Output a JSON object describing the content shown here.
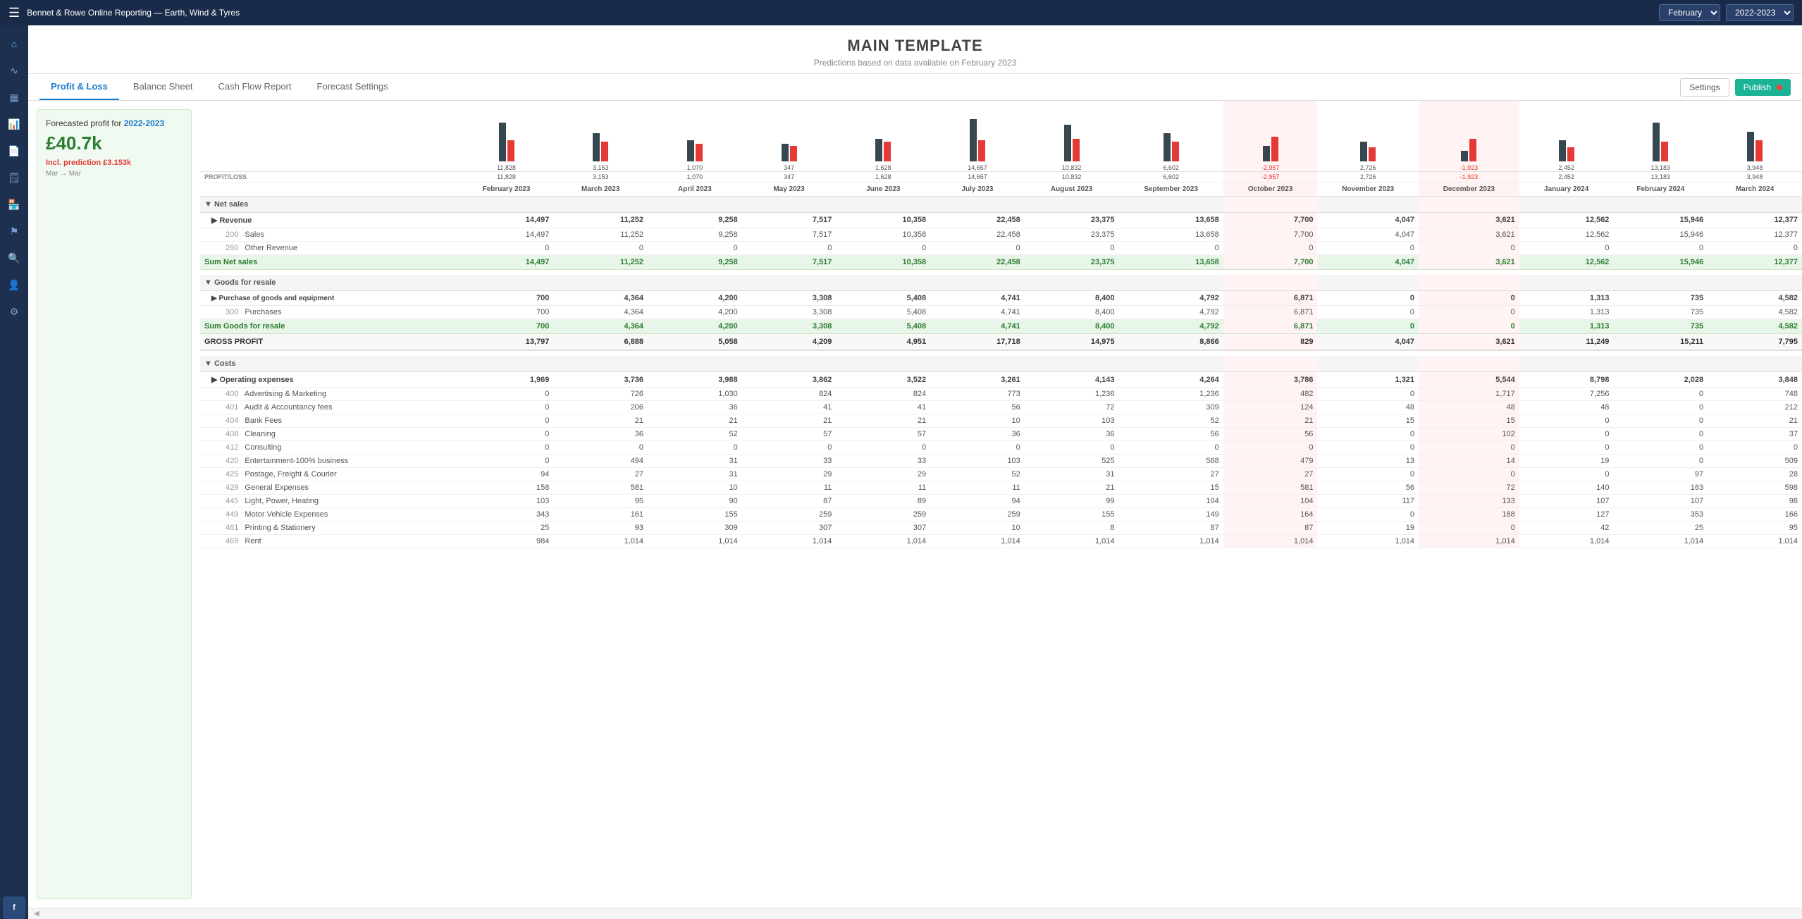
{
  "topBar": {
    "hamburger": "☰",
    "title": "Bennet & Rowe Online Reporting — Earth, Wind & Tyres",
    "monthSelector": "February",
    "yearSelector": "2022-2023"
  },
  "pageHeader": {
    "title": "MAIN TEMPLATE",
    "subtitle": "Predictions based on data available on February 2023"
  },
  "tabs": [
    {
      "id": "pl",
      "label": "Profit & Loss",
      "active": true
    },
    {
      "id": "bs",
      "label": "Balance Sheet",
      "active": false
    },
    {
      "id": "cfr",
      "label": "Cash Flow Report",
      "active": false
    },
    {
      "id": "fs",
      "label": "Forecast Settings",
      "active": false
    }
  ],
  "tabActions": {
    "settingsLabel": "Settings",
    "publishLabel": "Publish"
  },
  "forecastCard": {
    "forecastLabel": "Forecasted profit for",
    "forecastYear": "2022-2023",
    "amount": "£40.7k",
    "inclLabel": "Incl. prediction",
    "inclAmount": "£3.153k",
    "periodFrom": "Mar",
    "periodTo": "Mar"
  },
  "columns": [
    {
      "id": "feb23",
      "period": "February 2023",
      "profit": "11,828",
      "barDark": 55,
      "barRed": 30,
      "positive": true
    },
    {
      "id": "mar23",
      "period": "March 2023",
      "profit": "3,153",
      "barDark": 40,
      "barRed": 28,
      "positive": true
    },
    {
      "id": "apr23",
      "period": "April 2023",
      "profit": "1,070",
      "barDark": 30,
      "barRed": 25,
      "positive": true
    },
    {
      "id": "may23",
      "period": "May 2023",
      "profit": "347",
      "barDark": 25,
      "barRed": 22,
      "positive": true
    },
    {
      "id": "jun23",
      "period": "June 2023",
      "profit": "1,628",
      "barDark": 32,
      "barRed": 28,
      "positive": true
    },
    {
      "id": "jul23",
      "period": "July 2023",
      "profit": "14,657",
      "barDark": 60,
      "barRed": 30,
      "positive": true
    },
    {
      "id": "aug23",
      "period": "August 2023",
      "profit": "10,832",
      "barDark": 52,
      "barRed": 32,
      "positive": true
    },
    {
      "id": "sep23",
      "period": "September 2023",
      "profit": "6,602",
      "barDark": 40,
      "barRed": 28,
      "positive": true
    },
    {
      "id": "oct23",
      "period": "October 2023",
      "profit": "-2,957",
      "barDark": 22,
      "barRed": 35,
      "positive": false
    },
    {
      "id": "nov23",
      "period": "November 2023",
      "profit": "2,726",
      "barDark": 28,
      "barRed": 20,
      "positive": true
    },
    {
      "id": "dec23",
      "period": "December 2023",
      "profit": "-1,923",
      "barDark": 15,
      "barRed": 32,
      "positive": false
    },
    {
      "id": "jan24",
      "period": "January 2024",
      "profit": "2,452",
      "barDark": 30,
      "barRed": 20,
      "positive": true
    },
    {
      "id": "feb24",
      "period": "February 2024",
      "profit": "13,183",
      "barDark": 55,
      "barRed": 28,
      "positive": true
    },
    {
      "id": "mar24",
      "period": "March 2024",
      "profit": "3,948",
      "barDark": 42,
      "barRed": 30,
      "positive": true
    }
  ],
  "rows": {
    "netSalesLabel": "Net sales",
    "revenueLabel": "▶ Revenue",
    "salesCode": "200",
    "salesLabel": "Sales",
    "otherRevenueCode": "260",
    "otherRevenueLabel": "Other Revenue",
    "sumNetSalesLabel": "Sum Net sales",
    "goodsForResaleLabel": "Goods for resale",
    "purchaseLabel": "▶ Purchase of goods and equipment",
    "purchasesCode": "300",
    "purchasesLabel": "Purchases",
    "sumGoodsLabel": "Sum Goods for resale",
    "grossProfitLabel": "GROSS PROFIT",
    "costsLabel": "Costs",
    "operatingExpensesLabel": "▶ Operating expenses",
    "advertisingCode": "400",
    "advertisingLabel": "Advertising & Marketing",
    "auditCode": "401",
    "auditLabel": "Audit & Accountancy fees",
    "bankCode": "404",
    "bankLabel": "Bank Fees",
    "cleaningCode": "408",
    "cleaningLabel": "Cleaning",
    "consultingCode": "412",
    "consultingLabel": "Consulting",
    "entertainmentCode": "420",
    "entertainmentLabel": "Entertainment-100% business",
    "postageCode": "425",
    "postageLabel": "Postage, Freight & Courier",
    "generalCode": "429",
    "generalLabel": "General Expenses",
    "lightCode": "445",
    "lightLabel": "Light, Power, Heating",
    "motorCode": "449",
    "motorLabel": "Motor Vehicle Expenses",
    "printingCode": "461",
    "printingLabel": "Printing & Stationery",
    "rentCode": "469",
    "rentLabel": "Rent"
  },
  "data": {
    "netSales": {
      "revenue": [
        14497,
        11252,
        9258,
        7517,
        10358,
        22458,
        23375,
        13658,
        7700,
        4047,
        3621,
        12562,
        15946,
        12377
      ],
      "sales": [
        14497,
        11252,
        9258,
        7517,
        10358,
        22458,
        23375,
        13658,
        7700,
        4047,
        3621,
        12562,
        15946,
        12377
      ],
      "otherRevenue": [
        0,
        0,
        0,
        0,
        0,
        0,
        0,
        0,
        0,
        0,
        0,
        0,
        0,
        0
      ],
      "sumNetSales": [
        14497,
        11252,
        9258,
        7517,
        10358,
        22458,
        23375,
        13658,
        7700,
        4047,
        3621,
        12562,
        15946,
        12377
      ]
    },
    "goodsForResale": {
      "purchase": [
        700,
        4364,
        4200,
        3308,
        5408,
        4741,
        8400,
        4792,
        6871,
        0,
        0,
        1313,
        735,
        4582
      ],
      "purchases": [
        700,
        4364,
        4200,
        3308,
        5408,
        4741,
        8400,
        4792,
        6871,
        0,
        0,
        1313,
        735,
        4582
      ],
      "sumGoods": [
        700,
        4364,
        4200,
        3308,
        5408,
        4741,
        8400,
        4792,
        6871,
        0,
        0,
        1313,
        735,
        4582
      ]
    },
    "grossProfit": [
      13797,
      6888,
      5058,
      4209,
      4951,
      17718,
      14975,
      8866,
      829,
      4047,
      3621,
      11249,
      15211,
      7795
    ],
    "costs": {
      "operatingExpenses": [
        1969,
        3736,
        3988,
        3862,
        3522,
        3261,
        4143,
        4264,
        3786,
        1321,
        5544,
        8798,
        2028,
        3848
      ],
      "advertising": [
        0,
        726,
        1030,
        824,
        824,
        773,
        1236,
        1236,
        482,
        0,
        1717,
        7256,
        0,
        748
      ],
      "audit": [
        0,
        206,
        36,
        41,
        41,
        56,
        72,
        309,
        124,
        48,
        48,
        48,
        0,
        212
      ],
      "bank": [
        0,
        21,
        21,
        21,
        21,
        10,
        103,
        52,
        21,
        15,
        15,
        0,
        0,
        21
      ],
      "cleaning": [
        0,
        36,
        52,
        57,
        57,
        36,
        36,
        56,
        56,
        0,
        102,
        0,
        0,
        37
      ],
      "consulting": [
        0,
        0,
        0,
        0,
        0,
        0,
        0,
        0,
        0,
        0,
        0,
        0,
        0,
        0
      ],
      "entertainment": [
        0,
        494,
        31,
        33,
        33,
        103,
        525,
        568,
        479,
        13,
        14,
        19,
        0,
        509
      ],
      "postage": [
        94,
        27,
        31,
        29,
        29,
        52,
        31,
        27,
        27,
        0,
        0,
        0,
        97,
        28
      ],
      "general": [
        158,
        581,
        10,
        11,
        11,
        11,
        21,
        15,
        581,
        56,
        72,
        140,
        163,
        598
      ],
      "light": [
        103,
        95,
        90,
        87,
        89,
        94,
        99,
        104,
        104,
        117,
        133,
        107,
        107,
        98
      ],
      "motor": [
        343,
        161,
        155,
        259,
        259,
        259,
        155,
        149,
        164,
        0,
        188,
        127,
        353,
        166
      ],
      "printing": [
        25,
        93,
        309,
        307,
        307,
        10,
        8,
        87,
        87,
        19,
        0,
        42,
        25,
        95
      ],
      "rent": [
        984,
        1014,
        1014,
        1014,
        1014,
        1014,
        1014,
        1014,
        1014,
        1014,
        1014,
        1014,
        1014,
        1014
      ]
    }
  },
  "sidebarIcons": [
    {
      "name": "home-icon",
      "symbol": "⌂"
    },
    {
      "name": "chart-icon",
      "symbol": "∿"
    },
    {
      "name": "bar-chart-icon",
      "symbol": "▦"
    },
    {
      "name": "line-chart-icon",
      "symbol": "📈"
    },
    {
      "name": "document-icon",
      "symbol": "📄"
    },
    {
      "name": "report-icon",
      "symbol": "🗒"
    },
    {
      "name": "store-icon",
      "symbol": "🏪"
    },
    {
      "name": "flag-icon",
      "symbol": "⚑"
    },
    {
      "name": "search-icon",
      "symbol": "🔍"
    },
    {
      "name": "user-icon",
      "symbol": "👤"
    },
    {
      "name": "settings-icon",
      "symbol": "⚙"
    },
    {
      "name": "logo-icon",
      "symbol": "f"
    }
  ]
}
